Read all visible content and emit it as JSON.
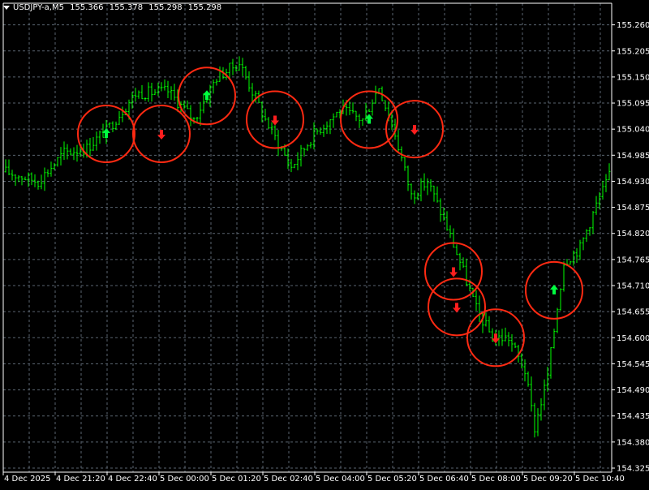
{
  "window": {
    "symbol": "USDJPY-a,M5",
    "open": "155.366",
    "high": "155.378",
    "low": "155.298",
    "close": "155.298"
  },
  "colors": {
    "background": "#000000",
    "grid": "#5a6470",
    "bars": "#00ff00",
    "axis": "#ffffff",
    "circle": "#ff2a12",
    "arrow_up": "#00ff40",
    "arrow_down": "#ff1e1e"
  },
  "chart_data": {
    "type": "ohlc",
    "title": "",
    "ylim": [
      154.325,
      155.285
    ],
    "y_ticks": [
      "155.260",
      "155.205",
      "155.150",
      "155.095",
      "155.040",
      "154.985",
      "154.930",
      "154.875",
      "154.820",
      "154.765",
      "154.710",
      "154.655",
      "154.600",
      "154.545",
      "154.490",
      "154.435",
      "154.380",
      "154.325"
    ],
    "x_ticks": [
      "4 Dec 2025",
      "4 Dec 21:20",
      "4 Dec 22:40",
      "5 Dec 00:00",
      "5 Dec 01:20",
      "5 Dec 02:40",
      "5 Dec 04:00",
      "5 Dec 05:20",
      "5 Dec 06:40",
      "5 Dec 08:00",
      "5 Dec 09:20",
      "5 Dec 10:40"
    ],
    "bar_count": 187,
    "price_path": [
      [
        0,
        154.95
      ],
      [
        10,
        154.93
      ],
      [
        18,
        154.99
      ],
      [
        25,
        155.0
      ],
      [
        32,
        155.045
      ],
      [
        40,
        155.115
      ],
      [
        50,
        155.12
      ],
      [
        58,
        155.06
      ],
      [
        65,
        155.15
      ],
      [
        72,
        155.18
      ],
      [
        80,
        155.06
      ],
      [
        88,
        154.96
      ],
      [
        95,
        155.03
      ],
      [
        103,
        155.08
      ],
      [
        110,
        155.06
      ],
      [
        115,
        155.13
      ],
      [
        120,
        155.03
      ],
      [
        125,
        154.9
      ],
      [
        130,
        154.93
      ],
      [
        135,
        154.85
      ],
      [
        140,
        154.76
      ],
      [
        145,
        154.66
      ],
      [
        150,
        154.6
      ],
      [
        155,
        154.6
      ],
      [
        160,
        154.53
      ],
      [
        163,
        154.41
      ],
      [
        167,
        154.52
      ],
      [
        172,
        154.76
      ],
      [
        177,
        154.79
      ],
      [
        182,
        154.88
      ],
      [
        186,
        154.94
      ]
    ],
    "signals": [
      {
        "bar": 31,
        "type": "buy",
        "price": 155.03
      },
      {
        "bar": 48,
        "type": "sell",
        "price": 155.03
      },
      {
        "bar": 62,
        "type": "buy",
        "price": 155.11
      },
      {
        "bar": 83,
        "type": "sell",
        "price": 155.06
      },
      {
        "bar": 112,
        "type": "buy",
        "price": 155.06
      },
      {
        "bar": 126,
        "type": "sell",
        "price": 155.04
      },
      {
        "bar": 138,
        "type": "sell",
        "price": 154.74
      },
      {
        "bar": 139,
        "type": "sell",
        "price": 154.665
      },
      {
        "bar": 151,
        "type": "sell",
        "price": 154.6
      },
      {
        "bar": 169,
        "type": "buy",
        "price": 154.7
      }
    ]
  }
}
